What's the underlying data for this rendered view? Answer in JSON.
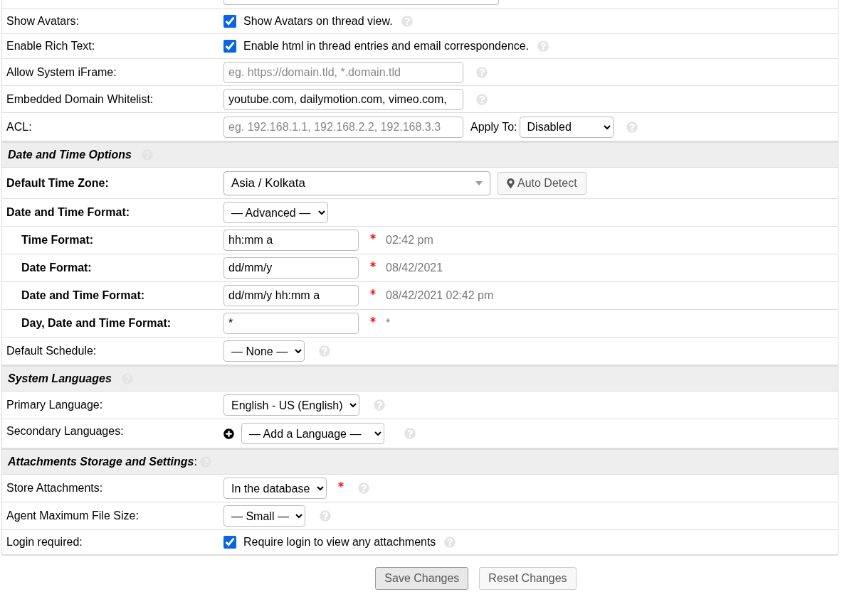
{
  "rows": [
    {
      "kind": "cut"
    },
    {
      "kind": "checkbox",
      "label": "Show Avatars:",
      "checked": true,
      "text": "Show Avatars on thread view.",
      "help": true
    },
    {
      "kind": "checkbox",
      "label": "Enable Rich Text:",
      "checked": true,
      "text": "Enable html in thread entries and email correspondence.",
      "help": true
    },
    {
      "kind": "text",
      "label": "Allow System iFrame:",
      "placeholder": "eg. https://domain.tld, *.domain.tld",
      "help": true
    },
    {
      "kind": "text",
      "label": "Embedded Domain Whitelist:",
      "value": "youtube.com, dailymotion.com, vimeo.com,",
      "help": true
    },
    {
      "kind": "acl",
      "label": "ACL:",
      "placeholder": "eg. 192.168.1.1, 192.168.2.2, 192.168.3.3",
      "apply_label": "Apply To:",
      "apply_value": "Disabled",
      "help": true
    },
    {
      "kind": "section",
      "title": "Date and Time Options",
      "help": true
    },
    {
      "kind": "timezone",
      "label": "Default Time Zone:",
      "bold": true,
      "value": "Asia / Kolkata",
      "button": "Auto Detect"
    },
    {
      "kind": "select",
      "label": "Date and Time Format:",
      "bold": true,
      "value": "— Advanced —",
      "help": false
    },
    {
      "kind": "format",
      "label": "Time Format:",
      "value": "hh:mm a",
      "required": true,
      "preview": "02:42 pm"
    },
    {
      "kind": "format",
      "label": "Date Format:",
      "value": "dd/mm/y",
      "required": true,
      "preview": "08/42/2021"
    },
    {
      "kind": "format",
      "label": "Date and Time Format:",
      "value": "dd/mm/y hh:mm a",
      "required": true,
      "preview": "08/42/2021 02:42 pm"
    },
    {
      "kind": "format",
      "label": "Day, Date and Time Format:",
      "value": "*",
      "required": true,
      "preview": "*"
    },
    {
      "kind": "select",
      "label": "Default Schedule:",
      "value": "— None —",
      "help": true
    },
    {
      "kind": "section",
      "title": "System Languages",
      "help": true
    },
    {
      "kind": "select",
      "label": "Primary Language:",
      "value": "English - US (English)",
      "help": true
    },
    {
      "kind": "language",
      "label": "Secondary Languages:",
      "value": "— Add a Language —",
      "help": true
    },
    {
      "kind": "section",
      "title": "Attachments Storage and Settings",
      "suffix": ":",
      "help": true
    },
    {
      "kind": "select",
      "label": "Store Attachments:",
      "value": "In the database",
      "required": true,
      "help": true
    },
    {
      "kind": "select",
      "label": "Agent Maximum File Size:",
      "value": "— Small —",
      "help": true
    },
    {
      "kind": "checkbox",
      "label": "Login required:",
      "checked": true,
      "text": "Require login to view any attachments",
      "help": true
    }
  ],
  "buttons": [
    {
      "label": "Save Changes",
      "kind": "primary"
    },
    {
      "label": "Reset Changes",
      "kind": "secondary"
    }
  ]
}
